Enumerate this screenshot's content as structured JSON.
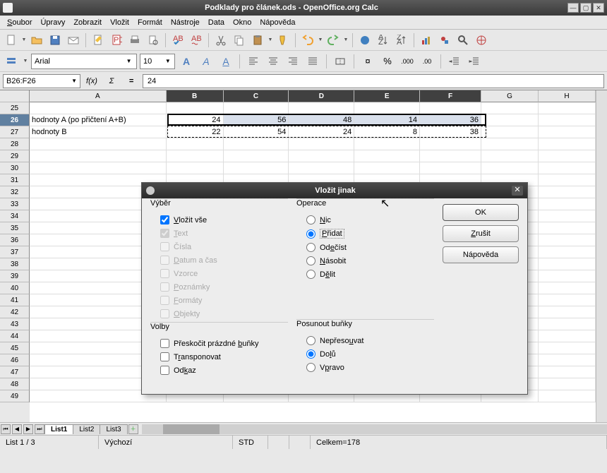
{
  "titlebar": {
    "title": "Podklady pro článek.ods - OpenOffice.org Calc"
  },
  "menu": {
    "soubor": "Soubor",
    "upravy": "Úpravy",
    "zobrazit": "Zobrazit",
    "vlozit": "Vložit",
    "format": "Formát",
    "nastroje": "Nástroje",
    "data": "Data",
    "okno": "Okno",
    "napoveda": "Nápověda"
  },
  "font": {
    "name": "Arial",
    "size": "10"
  },
  "cellbar": {
    "ref": "B26:F26",
    "formula": "24",
    "fx": "f(x)",
    "sum": "Σ",
    "eq": "="
  },
  "columns": [
    "A",
    "B",
    "C",
    "D",
    "E",
    "F",
    "G",
    "H"
  ],
  "rows_start": 25,
  "rows_end": 49,
  "cells": {
    "A26": "hodnoty A (po přičtení A+B)",
    "B26": "24",
    "C26": "56",
    "D26": "48",
    "E26": "14",
    "F26": "36",
    "A27": "hodnoty B",
    "B27": "22",
    "C27": "54",
    "D27": "24",
    "E27": "8",
    "F27": "38"
  },
  "selected_cols": [
    "B",
    "C",
    "D",
    "E",
    "F"
  ],
  "sel_row": 26,
  "tabs": {
    "items": [
      "List1",
      "List2",
      "List3"
    ],
    "active": 0
  },
  "status": {
    "sheet": "List 1 / 3",
    "style": "Výchozí",
    "mode": "STD",
    "sum": "Celkem=178"
  },
  "dialog": {
    "title": "Vložit jinak",
    "vyber": {
      "label": "Výběr",
      "vse": "Vložit vše",
      "text": "Text",
      "cisla": "Čísla",
      "datum": "Datum a čas",
      "vzorce": "Vzorce",
      "poznamky": "Poznámky",
      "formaty": "Formáty",
      "objekty": "Objekty"
    },
    "volby": {
      "label": "Volby",
      "preskocit": "Přeskočit prázdné buňky",
      "transponovat": "Transponovat",
      "odkaz": "Odkaz"
    },
    "operace": {
      "label": "Operace",
      "nic": "Nic",
      "pridat": "Přidat",
      "odecist": "Odečíst",
      "nasobit": "Násobit",
      "delit": "Dělit"
    },
    "posun": {
      "label": "Posunout buňky",
      "nepre": "Nepřesouvat",
      "dolu": "Dolů",
      "vpravo": "Vpravo"
    },
    "buttons": {
      "ok": "OK",
      "cancel": "Zrušit",
      "help": "Nápověda"
    }
  },
  "col_widths": {
    "A": 196,
    "B": 82,
    "C": 94,
    "D": 94,
    "E": 94,
    "F": 88,
    "G": 82,
    "H": 82
  }
}
